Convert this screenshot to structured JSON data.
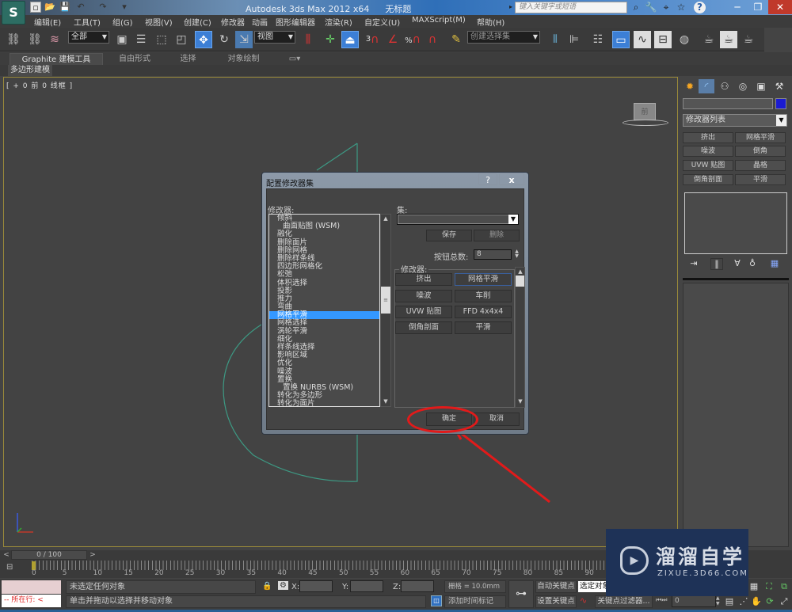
{
  "window": {
    "app_title": "Autodesk 3ds Max  2012 x64",
    "doc_title": "无标题",
    "search_placeholder": "键入关键字或短语",
    "app_logo": "S"
  },
  "quick_access": [
    "new-file-icon",
    "open-file-icon",
    "save-icon",
    "undo-icon",
    "redo-icon",
    "customize-dropdown-icon"
  ],
  "menubar": [
    "编辑(E)",
    "工具(T)",
    "组(G)",
    "视图(V)",
    "创建(C)",
    "修改器",
    "动画",
    "图形编辑器",
    "渲染(R)",
    "自定义(U)",
    "MAXScript(M)",
    "帮助(H)"
  ],
  "toolbar": {
    "selection_filter": "全部",
    "ref_coord": "视图",
    "named_selection": "创建选择集",
    "snap_3d_label": "3",
    "percent_snap_label": "%"
  },
  "ribbon": {
    "tabs": [
      "Graphite 建模工具",
      "自由形式",
      "选择",
      "对象绘制"
    ],
    "sub_tab": "多边形建模"
  },
  "viewport": {
    "label": "[ + 0 前 0 线框 ]",
    "viewcube_face": "前"
  },
  "command_panel": {
    "modifier_list": "修改器列表",
    "buttons": [
      "挤出",
      "网格平滑",
      "噪波",
      "倒角",
      "UVW 贴图",
      "晶格",
      "倒角剖面",
      "平滑"
    ],
    "object_color": "#1b1bd0"
  },
  "dialog": {
    "title": "配置修改器集",
    "help": "?",
    "close": "x",
    "modifiers_label": "修改器:",
    "sets_label": "集:",
    "set_value": "",
    "save": "保存",
    "delete": "删除",
    "count_label": "按钮总数:",
    "count_value": "8",
    "group_label": "修改器:",
    "list": [
      {
        "label": "倾斜",
        "indent": false
      },
      {
        "label": "曲面贴图 (WSM)",
        "indent": true
      },
      {
        "label": "融化",
        "indent": false
      },
      {
        "label": "删除面片",
        "indent": false
      },
      {
        "label": "删除网格",
        "indent": false
      },
      {
        "label": "删除样条线",
        "indent": false
      },
      {
        "label": "四边形网格化",
        "indent": false
      },
      {
        "label": "松弛",
        "indent": false
      },
      {
        "label": "体积选择",
        "indent": false
      },
      {
        "label": "投影",
        "indent": false
      },
      {
        "label": "推力",
        "indent": false
      },
      {
        "label": "弯曲",
        "indent": false
      },
      {
        "label": "网格平滑",
        "indent": false,
        "selected": true
      },
      {
        "label": "网格选择",
        "indent": false
      },
      {
        "label": "涡轮平滑",
        "indent": false
      },
      {
        "label": "细化",
        "indent": false
      },
      {
        "label": "样条线选择",
        "indent": false
      },
      {
        "label": "影响区域",
        "indent": false
      },
      {
        "label": "优化",
        "indent": false
      },
      {
        "label": "噪波",
        "indent": false
      },
      {
        "label": "置换",
        "indent": false
      },
      {
        "label": "置换 NURBS (WSM)",
        "indent": true
      },
      {
        "label": "转化为多边形",
        "indent": false
      },
      {
        "label": "转化为面片",
        "indent": false
      }
    ],
    "mod_buttons": [
      "挤出",
      "网格平滑",
      "噪波",
      "车削",
      "UVW 贴图",
      "FFD 4x4x4",
      "倒角剖面",
      "平滑"
    ],
    "ok": "确定",
    "cancel": "取消"
  },
  "timeline": {
    "position": "0 / 100",
    "prev": "<",
    "next": ">",
    "ticks": [
      "0",
      "5",
      "10",
      "15",
      "20",
      "25",
      "30",
      "35",
      "40",
      "45",
      "50",
      "55",
      "60",
      "65",
      "70",
      "75",
      "80",
      "85",
      "90"
    ]
  },
  "status": {
    "maxscript_line": "--  所在行:  <",
    "selection": "未选定任何对象",
    "prompt": "单击并拖动以选择并移动对象",
    "x_label": "X:",
    "y_label": "Y:",
    "z_label": "Z:",
    "grid": "栅格 = 10.0mm",
    "add_time_tag": "添加时间标记",
    "auto_key": "自动关键点",
    "set_key": "设置关键点",
    "selected_combo": "选定对象",
    "key_filters": "关键点过滤器...",
    "frame": "0"
  },
  "watermark": {
    "title": "溜溜自学",
    "url": "ZIXUE.3D66.COM"
  },
  "annotation": {
    "color": "#e21a1a"
  }
}
